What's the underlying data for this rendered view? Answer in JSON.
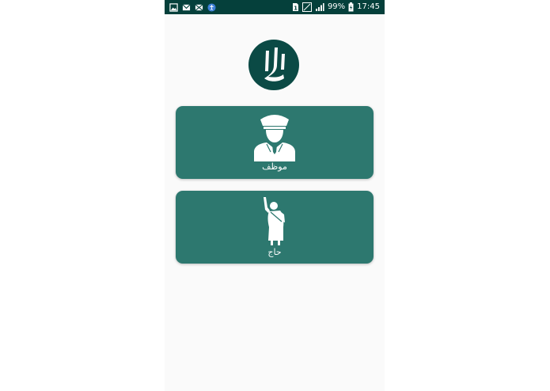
{
  "status_bar": {
    "battery_percent": "99%",
    "time": "17:45",
    "sim_slot": "1",
    "left_icons": [
      "gallery-icon",
      "mail-icon",
      "message-icon",
      "accessibility-icon"
    ]
  },
  "menu": {
    "employee_label": "موظف",
    "pilgrim_label": "حاج"
  },
  "colors": {
    "status_bar": "#05403b",
    "card": "#2d786f",
    "logo": "#0b4a45",
    "background": "#fafafa"
  }
}
